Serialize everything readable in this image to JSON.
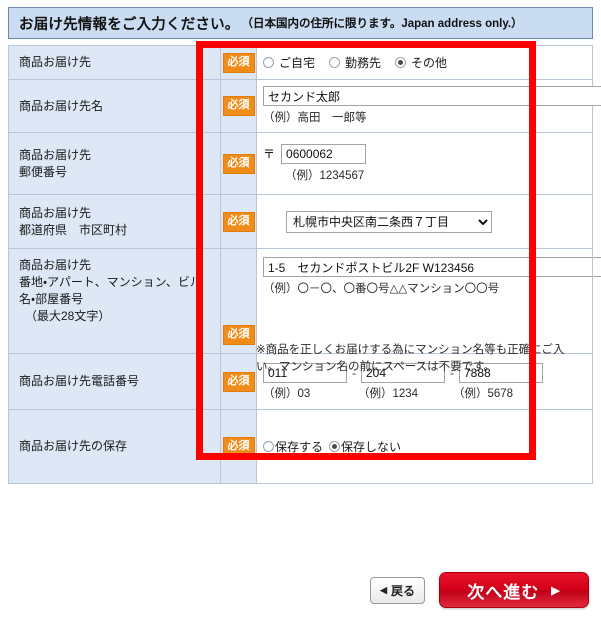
{
  "header": {
    "title": "お届け先情報をご入力ください。",
    "subtitle": "（日本国内の住所に限ります。Japan address only.）"
  },
  "required_badge": "必須",
  "rows": {
    "destination": {
      "label": "商品お届け先",
      "options": [
        {
          "label": "ご自宅",
          "selected": false
        },
        {
          "label": "勤務先",
          "selected": false
        },
        {
          "label": "その他",
          "selected": true
        }
      ]
    },
    "name": {
      "label": "商品お届け先名",
      "value": "セカンド太郎",
      "placeholder": "",
      "hint": "（例）高田　一郎等"
    },
    "zip": {
      "label_line1": "商品お届け先",
      "label_line2": "郵便番号",
      "mark": "〒",
      "value": "0600062",
      "hint": "（例）1234567"
    },
    "prefecture": {
      "label_line1": "商品お届け先",
      "label_line2": "都道府県　市区町村",
      "selected": "札幌市中央区南二条西７丁目",
      "options": [
        "札幌市中央区南二条西７丁目"
      ]
    },
    "address": {
      "label_line1": "商品お届け先",
      "label_line2": "番地・アパート、マンション、ビル",
      "label_line3": "名・部屋番号",
      "label_line4": "（最大28文字）",
      "value": "1-5　セカンドポストビル2F W123456",
      "hint": "（例）〇－〇、〇番〇号△△マンション〇〇号",
      "note_line1": "※商品を正しくお届けする為にマンション名等も正確にご入",
      "note_line2": "い。マンション名の前にスペースは不要です。"
    },
    "tel": {
      "label": "商品お届け先電話番号",
      "part1": "011",
      "part2": "204",
      "part3": "7888",
      "separator": "-",
      "hint1": "（例）03",
      "hint2": "（例）1234",
      "hint3": "（例）5678"
    },
    "save": {
      "label": "商品お届け先の保存",
      "options": [
        {
          "label": "保存する",
          "selected": false
        },
        {
          "label": "保存しない",
          "selected": true
        }
      ]
    }
  },
  "buttons": {
    "back": "戻る",
    "back_arrow": "◀",
    "next": "次へ進む",
    "next_arrow": "▶"
  },
  "colors": {
    "header_bg": "#c9dcf2",
    "label_bg": "#dde7f6",
    "required_badge_bg": "#f08c1a",
    "annotation_red": "#fe0000",
    "next_button_red": "#d4001a"
  }
}
